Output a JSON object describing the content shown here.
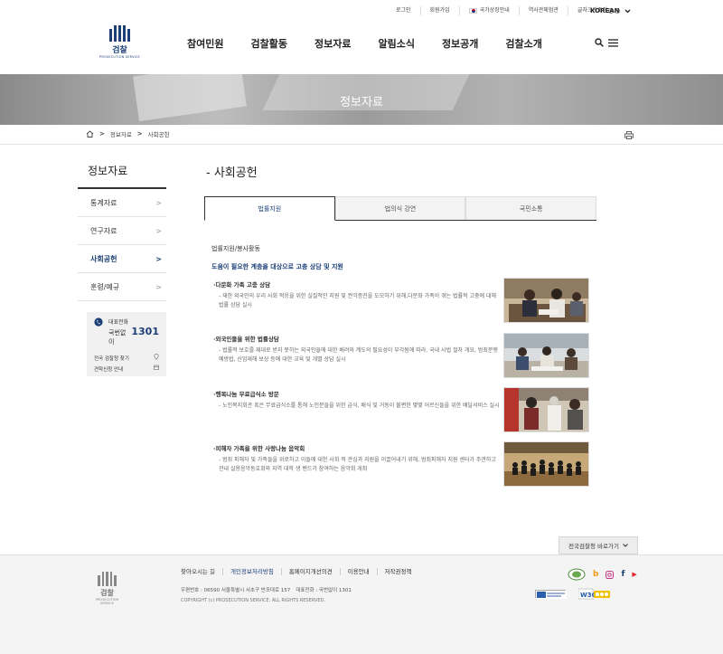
{
  "utility_links": [
    "로그인",
    "회원가입",
    "국가상징안내",
    "역사관체험관",
    "글자크기조정"
  ],
  "font_size_controls": {
    "plus": "+",
    "minus": "-"
  },
  "language": "KOREAN",
  "logo": {
    "name": "검찰",
    "subtitle": "PROSECUTION SERVICE"
  },
  "gnb": [
    "참여민원",
    "검찰활동",
    "정보자료",
    "알림소식",
    "정보공개",
    "검찰소개"
  ],
  "banner_title": "정보자료",
  "breadcrumb": [
    "정보자료",
    "사회공헌"
  ],
  "lnb": {
    "title": "정보자료",
    "items": [
      {
        "label": "통계자료",
        "active": false
      },
      {
        "label": "연구자료",
        "active": false
      },
      {
        "label": "사회공헌",
        "active": true
      },
      {
        "label": "훈령/예규",
        "active": false
      }
    ]
  },
  "contact": {
    "label": "대표전화",
    "prefix": "국번없이",
    "number": "1301",
    "links": [
      "전국 검찰청 찾기",
      "견학신청 안내"
    ]
  },
  "content": {
    "title": "- 사회공헌",
    "tabs": [
      "법률지원",
      "법의식 강연",
      "국민소통"
    ],
    "active_tab": 0,
    "section_title": "법률지원/봉사활동",
    "subtitle": "도움이 필요한 계층을 대상으로 고충 상담 및 지원",
    "entries": [
      {
        "heading": "·다문화 가족 고충 상담",
        "desc": "- 재한 외국인의 우리 사회 적응을 위한 실질적인 지원 및 권익증진을 도모하기 위해,다문화 가족이 겪는 법률적 고충에 대해 법률 상담 실시"
      },
      {
        "heading": "·외국인들을 위한 법률상담",
        "desc": "- 법률적 보호를 제대로 받지 못하는 외국인들에 대한 배려와 계도의 필요성이 부각됨에 따라, 국내 사법 절차 개요, 범죄분쟁 예방법, 산업재해 보상 등에 대한 교육 및 개별 상담 실시"
      },
      {
        "heading": "·행복나눔 무료급식소 방문",
        "desc": "- 노인복지회관 혹은 무료급식소를 통해 노인분들을 위한 급식, 배식 및 거동이 불편한 몇몇 어르신들을 위한 배달서비스 실시"
      },
      {
        "heading": "·피해자 가족을 위한 사랑나눔 음악회",
        "desc": "- 범죄 피해자 및 가족들을 위로하고 이들에 대한 사회 적 관심과 지원을 이끌어내기 위해, 범죄피해자 지원 센터가 주관하고 관내 실용음악동호회와 지역 대학 생 밴드가 참여하는 음악회 개최"
      }
    ]
  },
  "quick_link": "전국검찰청 바로가기",
  "footer": {
    "links": [
      "찾아오시는 길",
      "개인정보처리방침",
      "홈페이지개선의견",
      "이용안내",
      "저작권정책"
    ],
    "highlight_index": 1,
    "address": "우편번호 : 06590 서울특별시 서초구 반포대로 157",
    "phone": "대표전화 : 국번없이 1301",
    "copyright": "COPYRIGHT (c) PROSECUTION SERVICE. ALL RIGHTS RESERVED.",
    "sns": [
      "b",
      "instagram",
      "f",
      "▶"
    ]
  },
  "colors": {
    "brand": "#1b3f76",
    "accent_red": "#e0242a"
  }
}
